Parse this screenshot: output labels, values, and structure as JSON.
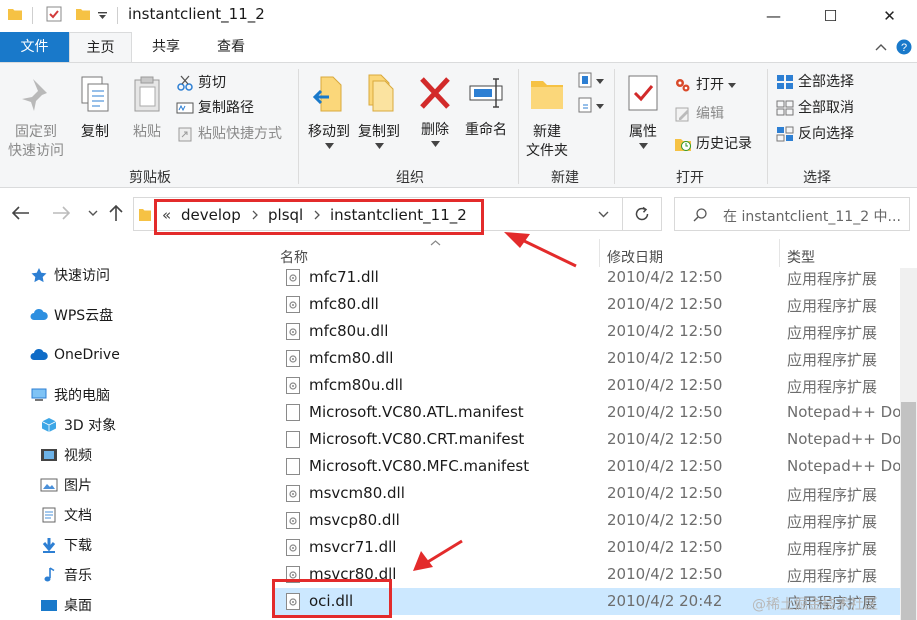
{
  "window": {
    "title": "instantclient_11_2",
    "minimize": "—",
    "maximize": "☐",
    "close": "✕"
  },
  "tabs": {
    "file": "文件",
    "home": "主页",
    "share": "共享",
    "view": "查看"
  },
  "ribbon": {
    "clipboard": {
      "group_label": "剪贴板",
      "pin_line1": "固定到",
      "pin_line2": "快速访问",
      "copy": "复制",
      "paste": "粘贴",
      "cut": "剪切",
      "copy_path": "复制路径",
      "paste_shortcut": "粘贴快捷方式"
    },
    "organize": {
      "group_label": "组织",
      "move_to": "移动到",
      "copy_to": "复制到",
      "delete": "删除",
      "rename": "重命名"
    },
    "new": {
      "group_label": "新建",
      "new_folder_line1": "新建",
      "new_folder_line2": "文件夹"
    },
    "open": {
      "group_label": "打开",
      "properties": "属性",
      "open": "打开",
      "edit": "编辑",
      "history": "历史记录"
    },
    "select": {
      "group_label": "选择",
      "select_all": "全部选择",
      "select_none": "全部取消",
      "invert": "反向选择"
    }
  },
  "address": {
    "overflow": "«",
    "crumbs": [
      "develop",
      "plsql",
      "instantclient_11_2"
    ],
    "search_placeholder": "在 instantclient_11_2 中..."
  },
  "nav": {
    "items": [
      "快速访问",
      "WPS云盘",
      "OneDrive",
      "我的电脑",
      "3D 对象",
      "视频",
      "图片",
      "文档",
      "下载",
      "音乐",
      "桌面"
    ]
  },
  "columns": {
    "name": "名称",
    "date": "修改日期",
    "type": "类型"
  },
  "files": [
    {
      "name": "mfc71.dll",
      "date": "2010/4/2 12:50",
      "type": "应用程序扩展"
    },
    {
      "name": "mfc80.dll",
      "date": "2010/4/2 12:50",
      "type": "应用程序扩展"
    },
    {
      "name": "mfc80u.dll",
      "date": "2010/4/2 12:50",
      "type": "应用程序扩展"
    },
    {
      "name": "mfcm80.dll",
      "date": "2010/4/2 12:50",
      "type": "应用程序扩展"
    },
    {
      "name": "mfcm80u.dll",
      "date": "2010/4/2 12:50",
      "type": "应用程序扩展"
    },
    {
      "name": "Microsoft.VC80.ATL.manifest",
      "date": "2010/4/2 12:50",
      "type": "Notepad++ Do"
    },
    {
      "name": "Microsoft.VC80.CRT.manifest",
      "date": "2010/4/2 12:50",
      "type": "Notepad++ Do"
    },
    {
      "name": "Microsoft.VC80.MFC.manifest",
      "date": "2010/4/2 12:50",
      "type": "Notepad++ Do"
    },
    {
      "name": "msvcm80.dll",
      "date": "2010/4/2 12:50",
      "type": "应用程序扩展"
    },
    {
      "name": "msvcp80.dll",
      "date": "2010/4/2 12:50",
      "type": "应用程序扩展"
    },
    {
      "name": "msvcr71.dll",
      "date": "2010/4/2 12:50",
      "type": "应用程序扩展"
    },
    {
      "name": "msvcr80.dll",
      "date": "2010/4/2 12:50",
      "type": "应用程序扩展"
    },
    {
      "name": "oci.dll",
      "date": "2010/4/2 20:42",
      "type": "应用程序扩展",
      "selected": true
    }
  ],
  "watermark": "@稀土掘金技术社区",
  "colors": {
    "accent": "#1979ca",
    "selection": "#cce8ff",
    "annotation": "#e32b2b"
  }
}
